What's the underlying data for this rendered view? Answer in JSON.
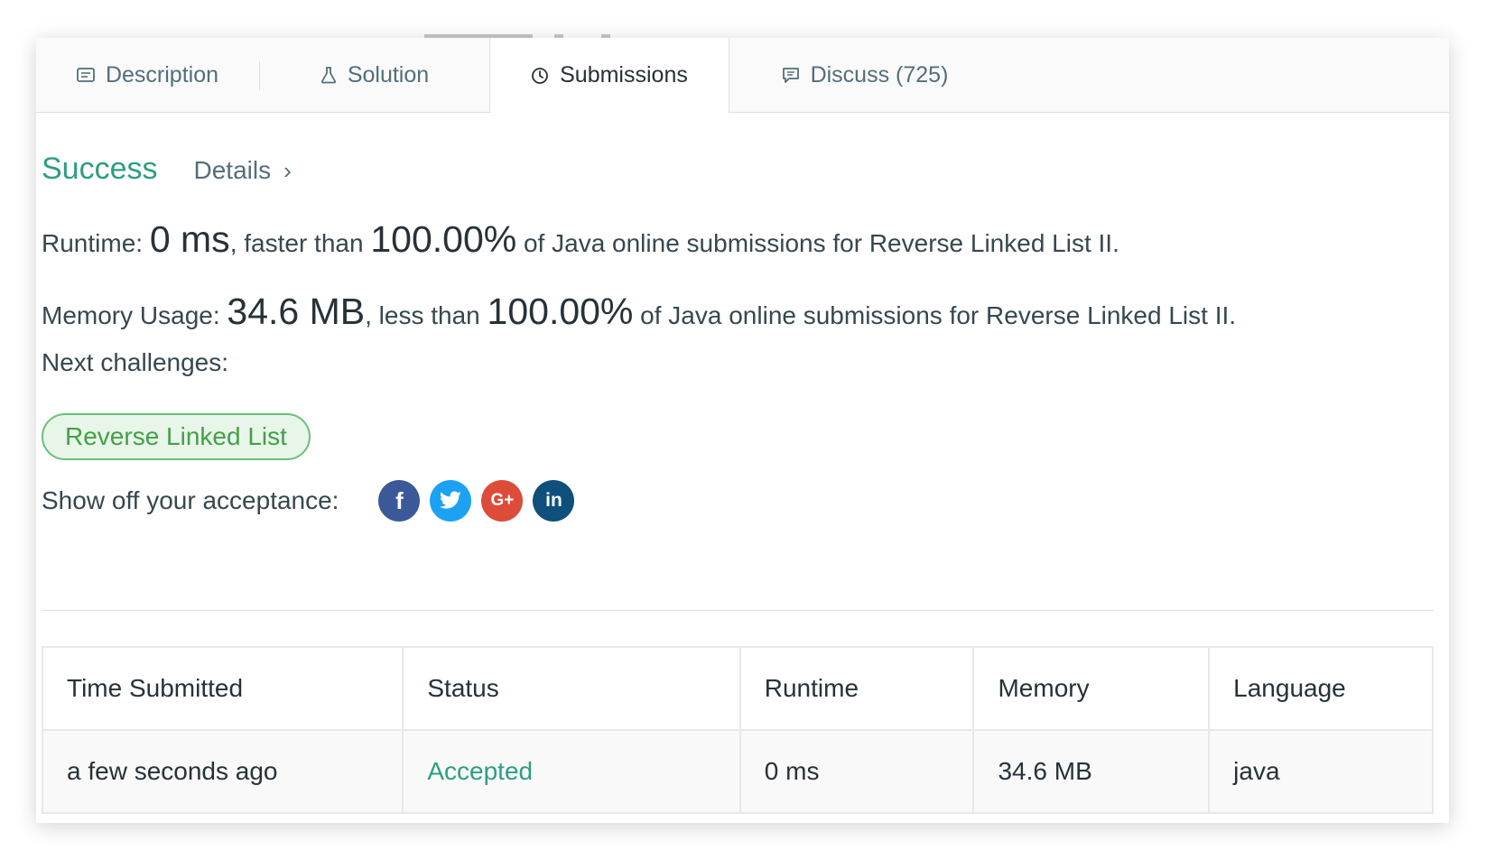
{
  "tabs": [
    {
      "label": "Description",
      "icon": "description-icon"
    },
    {
      "label": "Solution",
      "icon": "flask-icon"
    },
    {
      "label": "Submissions",
      "icon": "clock-icon"
    },
    {
      "label": "Discuss (725)",
      "icon": "comment-icon"
    }
  ],
  "active_tab": "Submissions",
  "result": {
    "status": "Success",
    "details_label": "Details",
    "details_icon": "chevron-right-icon"
  },
  "runtime": {
    "label": "Runtime:",
    "value": "0 ms",
    "comparison": ", faster than",
    "percent": "100.00%",
    "suffix": "of Java online submissions for Reverse Linked List II."
  },
  "memory": {
    "label": "Memory Usage:",
    "value": "34.6 MB",
    "comparison": ", less than",
    "percent": "100.00%",
    "suffix": "of Java online submissions for Reverse Linked List II."
  },
  "next_challenges": {
    "label": "Next challenges:",
    "items": [
      "Reverse Linked List"
    ]
  },
  "share": {
    "label": "Show off your acceptance:",
    "networks": [
      {
        "name": "facebook-icon",
        "glyph": "f",
        "color": "#3b5998"
      },
      {
        "name": "twitter-icon",
        "glyph": "t",
        "color": "#1da1f2"
      },
      {
        "name": "google-plus-icon",
        "glyph": "G+",
        "color": "#dd4b39"
      },
      {
        "name": "linkedin-icon",
        "glyph": "in",
        "color": "#0e4f7c"
      }
    ]
  },
  "table": {
    "headers": [
      "Time Submitted",
      "Status",
      "Runtime",
      "Memory",
      "Language"
    ],
    "rows": [
      [
        "a few seconds ago",
        "Accepted",
        "0 ms",
        "34.6 MB",
        "java"
      ]
    ]
  },
  "colors": {
    "accent_green": "#2e9d84",
    "pill_green": "#43a047"
  }
}
